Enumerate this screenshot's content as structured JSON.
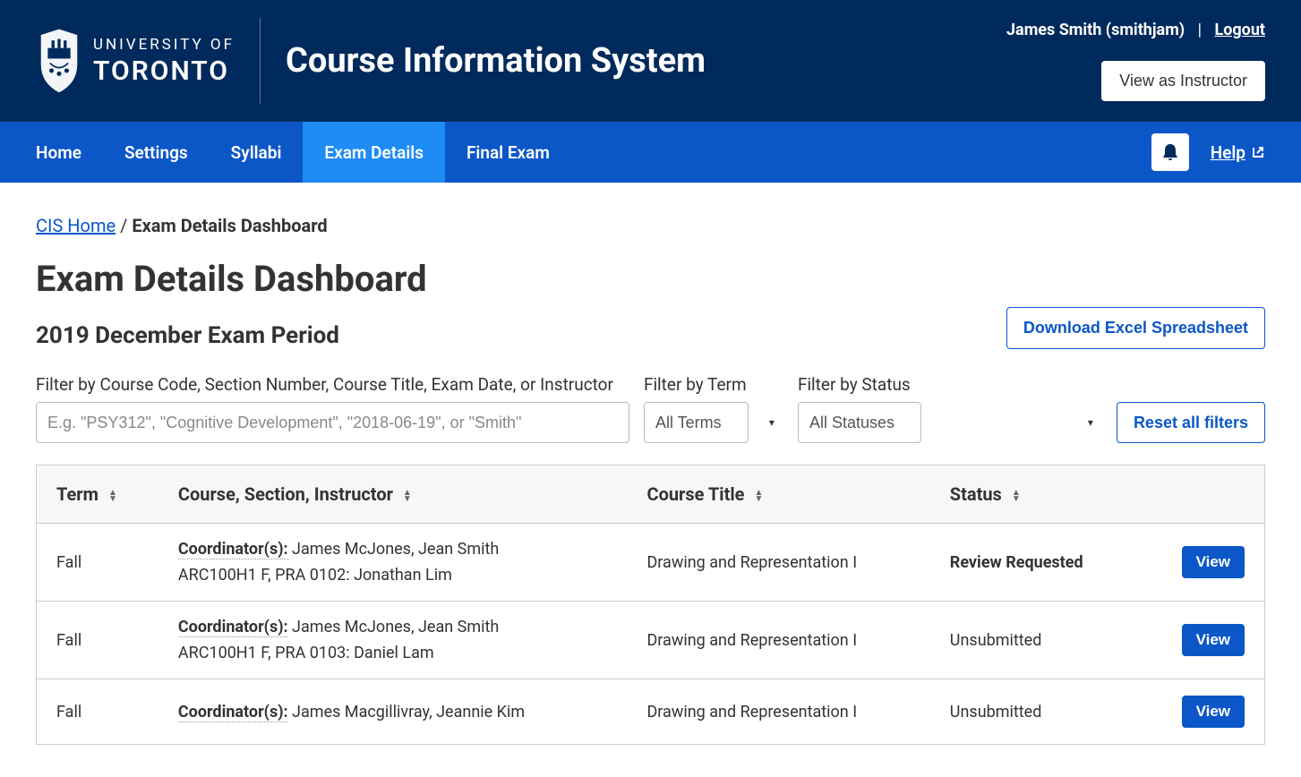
{
  "header": {
    "university": "UNIVERSITY OF",
    "university2": "TORONTO",
    "app_title": "Course Information System",
    "user_display": "James Smith (smithjam)",
    "logout": "Logout",
    "view_as": "View as Instructor"
  },
  "nav": {
    "items": [
      {
        "label": "Home",
        "active": false
      },
      {
        "label": "Settings",
        "active": false
      },
      {
        "label": "Syllabi",
        "active": false
      },
      {
        "label": "Exam Details",
        "active": true
      },
      {
        "label": "Final Exam",
        "active": false
      }
    ],
    "help": "Help"
  },
  "breadcrumb": {
    "home": "CIS Home",
    "sep": " / ",
    "current": "Exam Details Dashboard"
  },
  "page": {
    "title": "Exam Details Dashboard",
    "subtitle": "2019 December Exam Period",
    "download": "Download Excel Spreadsheet"
  },
  "filters": {
    "text_label": "Filter by Course Code, Section Number, Course Title, Exam Date, or Instructor",
    "text_placeholder": "E.g. \"PSY312\", \"Cognitive Development\", \"2018-06-19\", or \"Smith\"",
    "term_label": "Filter by Term",
    "term_value": "All Terms",
    "status_label": "Filter by Status",
    "status_value": "All Statuses",
    "reset": "Reset all filters"
  },
  "table": {
    "headers": {
      "term": "Term",
      "course": "Course, Section, Instructor",
      "title": "Course Title",
      "status": "Status"
    },
    "coordinator_label": "Coordinator(s):",
    "view_label": "View",
    "rows": [
      {
        "term": "Fall",
        "coordinators": "James McJones, Jean Smith",
        "section": "ARC100H1 F, PRA 0102: Jonathan Lim",
        "title": "Drawing and Representation I",
        "status": "Review Requested",
        "status_strong": true
      },
      {
        "term": "Fall",
        "coordinators": "James McJones, Jean Smith",
        "section": "ARC100H1 F, PRA 0103: Daniel Lam",
        "title": "Drawing and Representation I",
        "status": "Unsubmitted",
        "status_strong": false
      },
      {
        "term": "Fall",
        "coordinators": "James Macgillivray, Jeannie Kim",
        "section": "",
        "title": "Drawing and Representation I",
        "status": "Unsubmitted",
        "status_strong": false
      }
    ]
  }
}
